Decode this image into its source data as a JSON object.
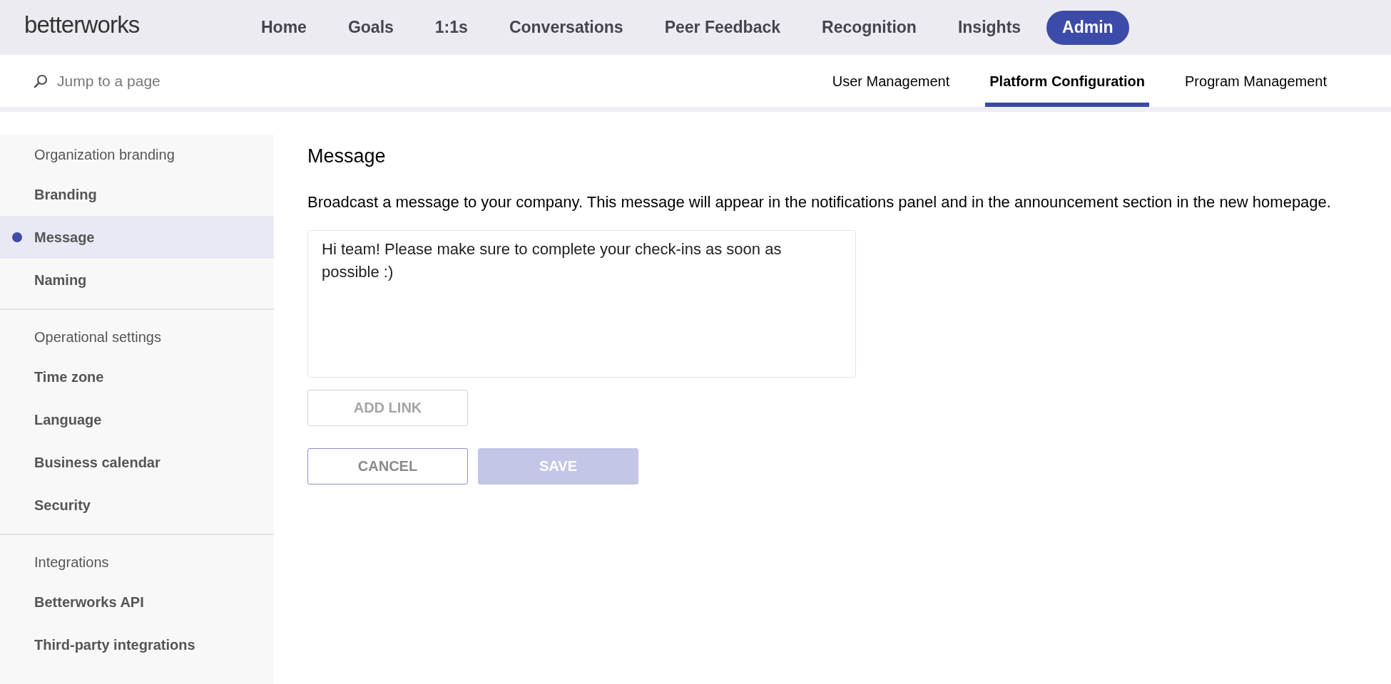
{
  "header": {
    "logo": "betterworks",
    "nav": [
      {
        "label": "Home",
        "selected": false
      },
      {
        "label": "Goals",
        "selected": false
      },
      {
        "label": "1:1s",
        "selected": false
      },
      {
        "label": "Conversations",
        "selected": false
      },
      {
        "label": "Peer Feedback",
        "selected": false
      },
      {
        "label": "Recognition",
        "selected": false
      },
      {
        "label": "Insights",
        "selected": false
      },
      {
        "label": "Admin",
        "selected": true
      }
    ]
  },
  "subnav": {
    "search": {
      "placeholder": "Jump to a page"
    },
    "tabs": [
      {
        "label": "User Management",
        "selected": false
      },
      {
        "label": "Platform Configuration",
        "selected": true
      },
      {
        "label": "Program Management",
        "selected": false
      }
    ]
  },
  "sidebar": {
    "sections": [
      {
        "heading": "Organization branding",
        "items": [
          {
            "label": "Branding",
            "selected": false
          },
          {
            "label": "Message",
            "selected": true
          },
          {
            "label": "Naming",
            "selected": false
          }
        ]
      },
      {
        "heading": "Operational settings",
        "items": [
          {
            "label": "Time zone",
            "selected": false
          },
          {
            "label": "Language",
            "selected": false
          },
          {
            "label": "Business calendar",
            "selected": false
          },
          {
            "label": "Security",
            "selected": false
          }
        ]
      },
      {
        "heading": "Integrations",
        "items": [
          {
            "label": "Betterworks API",
            "selected": false
          },
          {
            "label": "Third-party integrations",
            "selected": false
          }
        ]
      }
    ]
  },
  "content": {
    "title": "Message",
    "description": "Broadcast a message to your company. This message will appear in the notifications panel and in the announcement section in the new homepage.",
    "message": {
      "value": "Hi team! Please make sure to complete your check-ins as soon as possible :)"
    },
    "add_link": {
      "label": "ADD LINK",
      "disabled": true
    },
    "buttons": [
      {
        "label": "CANCEL",
        "kind": "outline",
        "disabled": false
      },
      {
        "label": "SAVE",
        "kind": "primary",
        "disabled": true
      }
    ]
  }
}
